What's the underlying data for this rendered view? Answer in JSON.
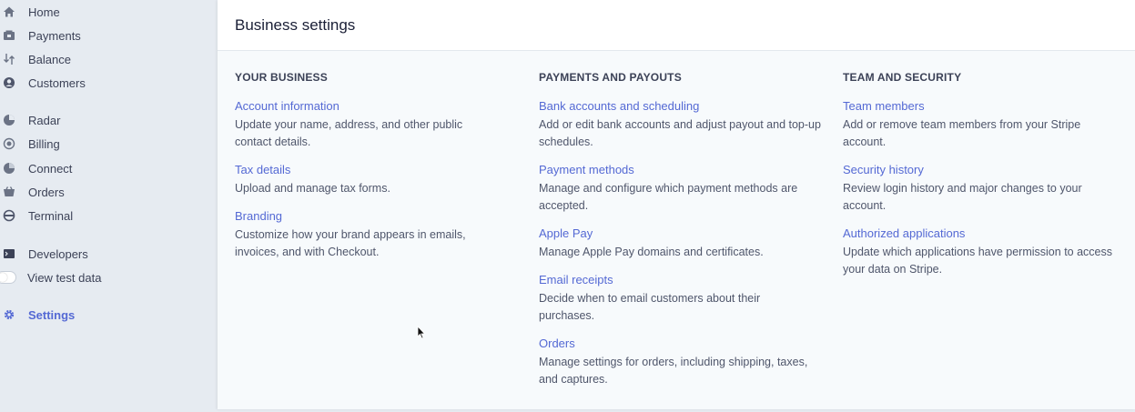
{
  "sidebar": {
    "items": [
      {
        "label": "Home",
        "icon": "home-icon"
      },
      {
        "label": "Payments",
        "icon": "payments-icon"
      },
      {
        "label": "Balance",
        "icon": "balance-icon"
      },
      {
        "label": "Customers",
        "icon": "customers-icon"
      },
      {
        "label": "Radar",
        "icon": "radar-icon"
      },
      {
        "label": "Billing",
        "icon": "billing-icon"
      },
      {
        "label": "Connect",
        "icon": "connect-icon"
      },
      {
        "label": "Orders",
        "icon": "orders-icon"
      },
      {
        "label": "Terminal",
        "icon": "terminal-icon"
      },
      {
        "label": "Developers",
        "icon": "developers-icon"
      },
      {
        "label": "View test data",
        "icon": "toggle"
      },
      {
        "label": "Settings",
        "icon": "gear-icon",
        "active": true
      }
    ],
    "accent_color": "#5469d4"
  },
  "page": {
    "title": "Business settings"
  },
  "sections": [
    {
      "heading": "YOUR BUSINESS",
      "entries": [
        {
          "link": "Account information",
          "desc": "Update your name, address, and other public contact details."
        },
        {
          "link": "Tax details",
          "desc": "Upload and manage tax forms."
        },
        {
          "link": "Branding",
          "desc": "Customize how your brand appears in emails, invoices, and with Checkout."
        }
      ]
    },
    {
      "heading": "PAYMENTS AND PAYOUTS",
      "entries": [
        {
          "link": "Bank accounts and scheduling",
          "desc": "Add or edit bank accounts and adjust payout and top-up schedules."
        },
        {
          "link": "Payment methods",
          "desc": "Manage and configure which payment methods are accepted."
        },
        {
          "link": "Apple Pay",
          "desc": "Manage Apple Pay domains and certificates."
        },
        {
          "link": "Email receipts",
          "desc": "Decide when to email customers about their purchases."
        },
        {
          "link": "Orders",
          "desc": "Manage settings for orders, including shipping, taxes, and captures."
        }
      ]
    },
    {
      "heading": "TEAM AND SECURITY",
      "entries": [
        {
          "link": "Team members",
          "desc": "Add or remove team members from your Stripe account."
        },
        {
          "link": "Security history",
          "desc": "Review login history and major changes to your account."
        },
        {
          "link": "Authorized applications",
          "desc": "Update which applications have permission to access your data on Stripe."
        }
      ]
    }
  ]
}
